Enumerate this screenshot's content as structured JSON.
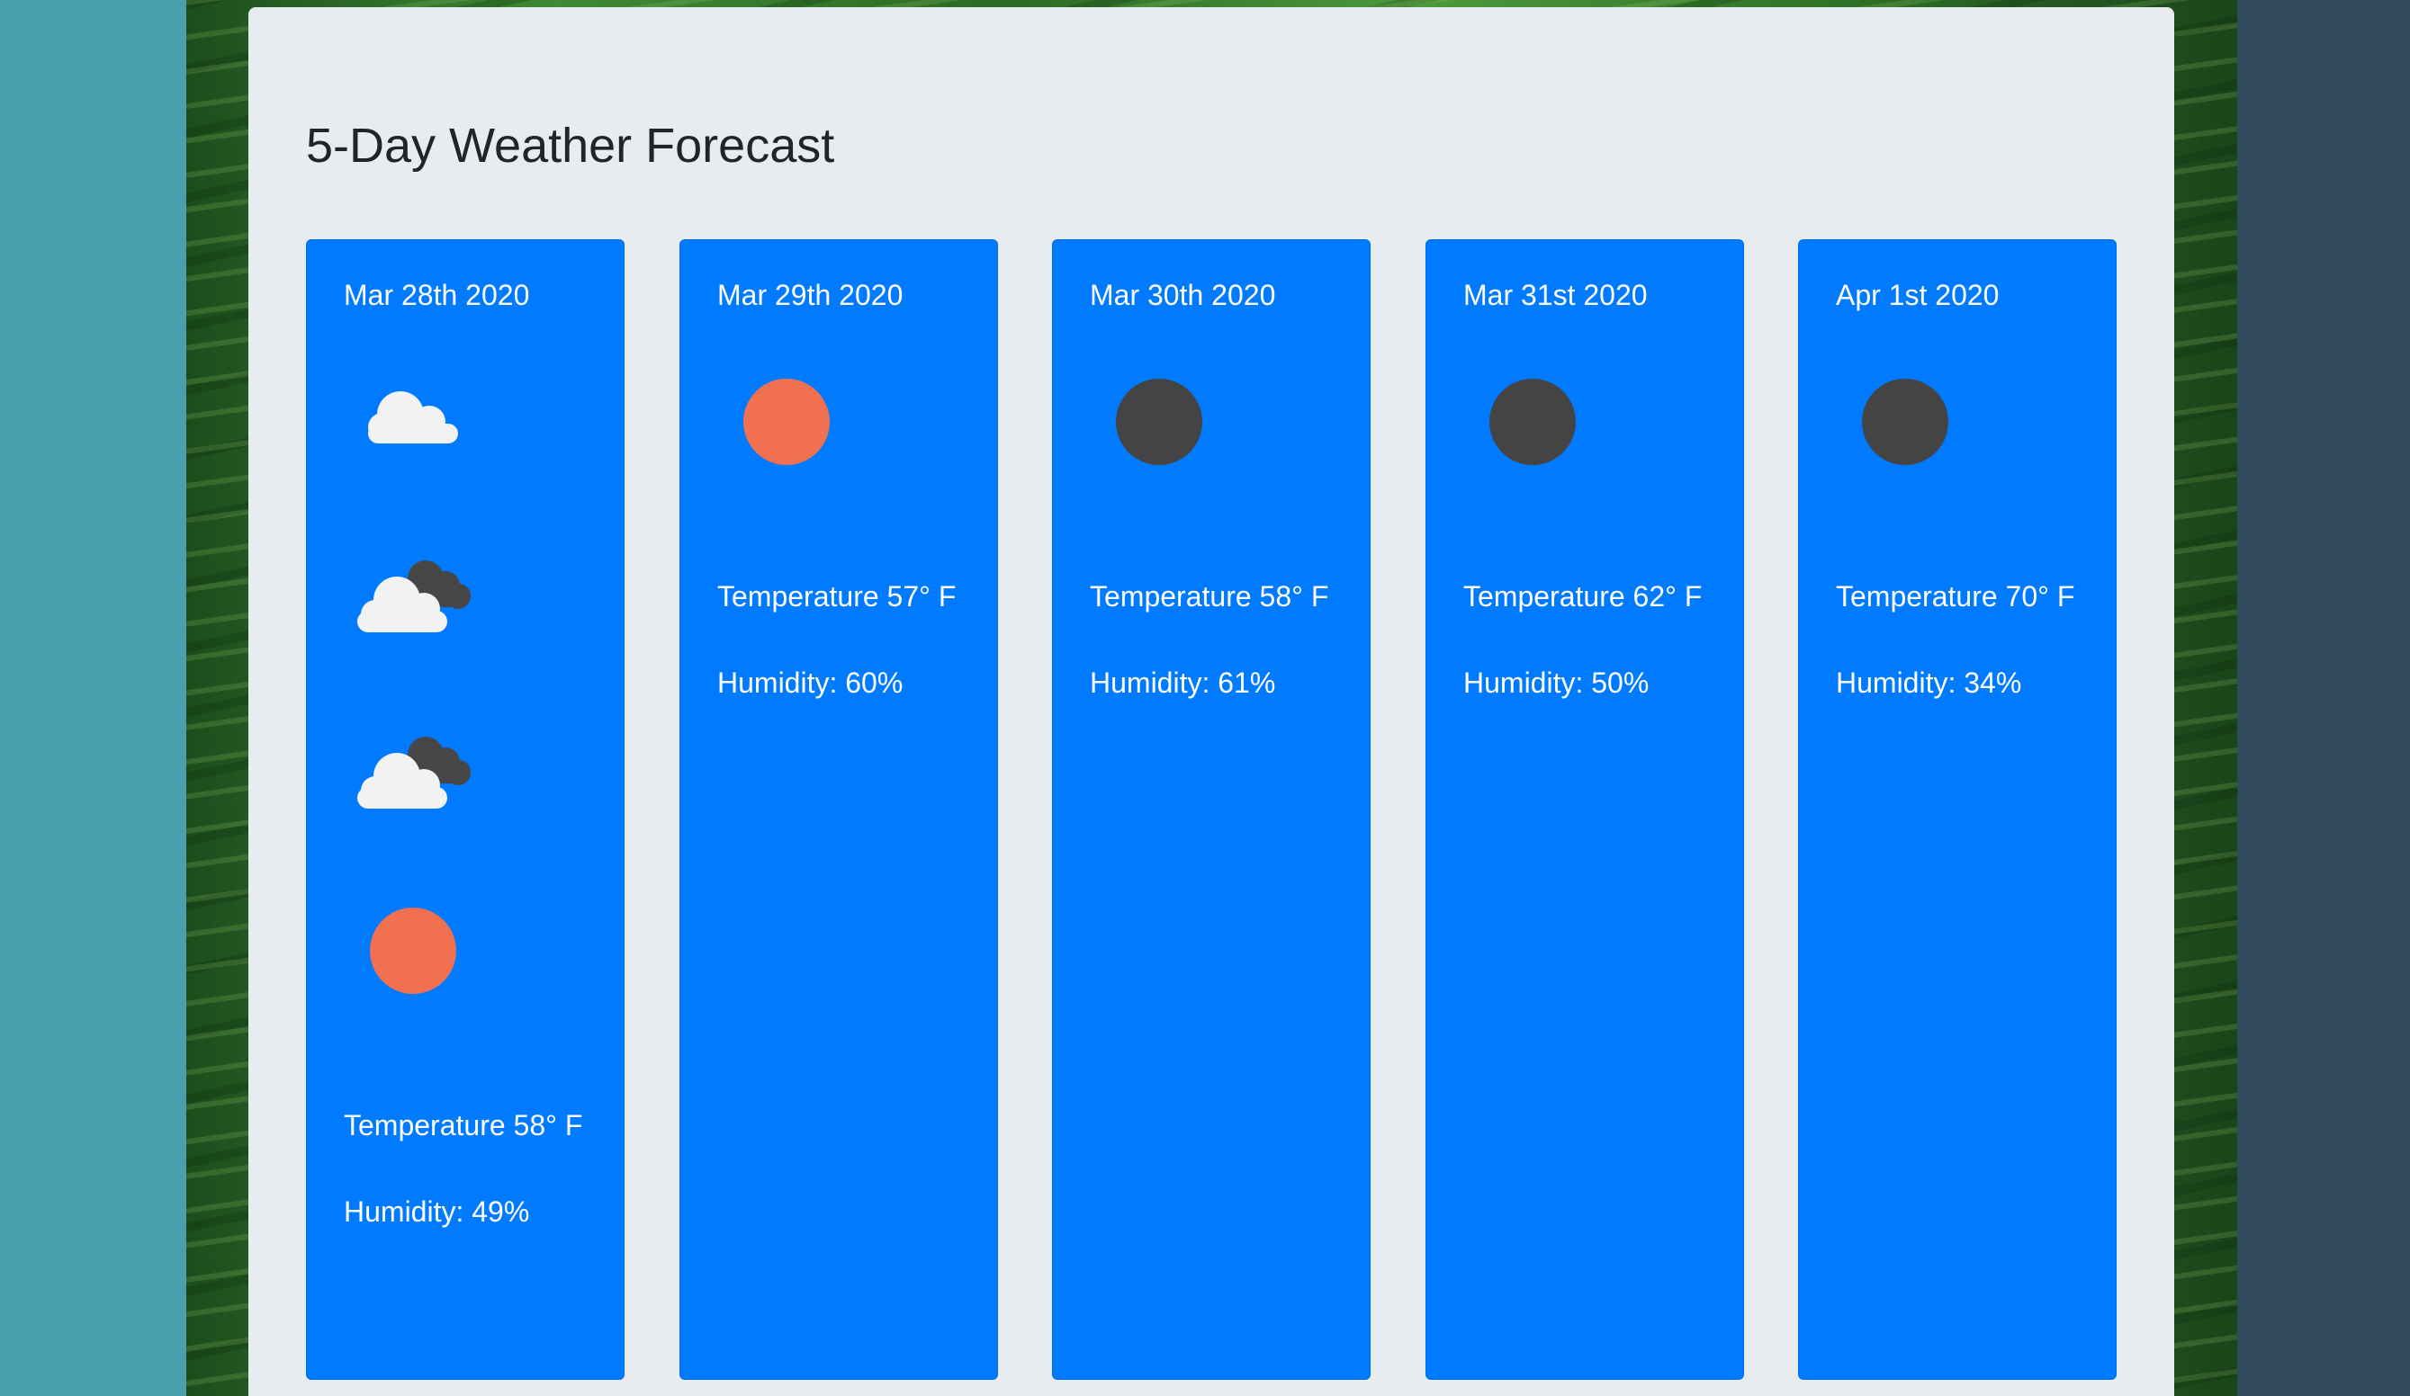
{
  "title": "5-Day Weather Forecast",
  "days": [
    {
      "date": "Mar 28th 2020",
      "icons": [
        "cloud-icon",
        "partly-dark-cloud-icon",
        "partly-dark-cloud-icon",
        "sun-icon"
      ],
      "temperature": "Temperature 58° F",
      "humidity": "Humidity: 49%"
    },
    {
      "date": "Mar 29th 2020",
      "icons": [
        "sun-icon"
      ],
      "temperature": "Temperature 57° F",
      "humidity": "Humidity: 60%"
    },
    {
      "date": "Mar 30th 2020",
      "icons": [
        "moon-icon"
      ],
      "temperature": "Temperature 58° F",
      "humidity": "Humidity: 61%"
    },
    {
      "date": "Mar 31st 2020",
      "icons": [
        "moon-icon"
      ],
      "temperature": "Temperature 62° F",
      "humidity": "Humidity: 50%"
    },
    {
      "date": "Apr 1st 2020",
      "icons": [
        "moon-icon"
      ],
      "temperature": "Temperature 70° F",
      "humidity": "Humidity: 34%"
    }
  ],
  "colors": {
    "panel": "#e9ecef",
    "card": "#007bff",
    "title": "#212529",
    "sun": "#f07050",
    "moon": "#444444",
    "cloud": "#f2f2f2",
    "dark_cloud": "#474747"
  }
}
